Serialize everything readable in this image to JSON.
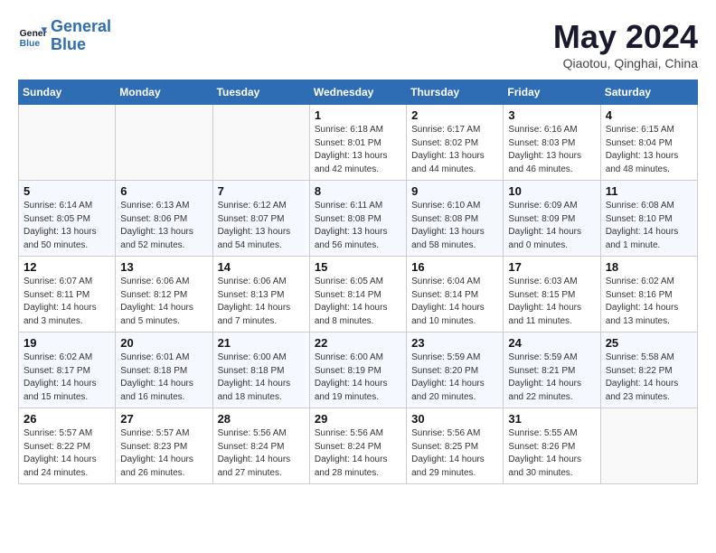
{
  "header": {
    "logo_line1": "General",
    "logo_line2": "Blue",
    "month_title": "May 2024",
    "location": "Qiaotou, Qinghai, China"
  },
  "weekdays": [
    "Sunday",
    "Monday",
    "Tuesday",
    "Wednesday",
    "Thursday",
    "Friday",
    "Saturday"
  ],
  "weeks": [
    [
      {
        "day": "",
        "info": ""
      },
      {
        "day": "",
        "info": ""
      },
      {
        "day": "",
        "info": ""
      },
      {
        "day": "1",
        "info": "Sunrise: 6:18 AM\nSunset: 8:01 PM\nDaylight: 13 hours\nand 42 minutes."
      },
      {
        "day": "2",
        "info": "Sunrise: 6:17 AM\nSunset: 8:02 PM\nDaylight: 13 hours\nand 44 minutes."
      },
      {
        "day": "3",
        "info": "Sunrise: 6:16 AM\nSunset: 8:03 PM\nDaylight: 13 hours\nand 46 minutes."
      },
      {
        "day": "4",
        "info": "Sunrise: 6:15 AM\nSunset: 8:04 PM\nDaylight: 13 hours\nand 48 minutes."
      }
    ],
    [
      {
        "day": "5",
        "info": "Sunrise: 6:14 AM\nSunset: 8:05 PM\nDaylight: 13 hours\nand 50 minutes."
      },
      {
        "day": "6",
        "info": "Sunrise: 6:13 AM\nSunset: 8:06 PM\nDaylight: 13 hours\nand 52 minutes."
      },
      {
        "day": "7",
        "info": "Sunrise: 6:12 AM\nSunset: 8:07 PM\nDaylight: 13 hours\nand 54 minutes."
      },
      {
        "day": "8",
        "info": "Sunrise: 6:11 AM\nSunset: 8:08 PM\nDaylight: 13 hours\nand 56 minutes."
      },
      {
        "day": "9",
        "info": "Sunrise: 6:10 AM\nSunset: 8:08 PM\nDaylight: 13 hours\nand 58 minutes."
      },
      {
        "day": "10",
        "info": "Sunrise: 6:09 AM\nSunset: 8:09 PM\nDaylight: 14 hours\nand 0 minutes."
      },
      {
        "day": "11",
        "info": "Sunrise: 6:08 AM\nSunset: 8:10 PM\nDaylight: 14 hours\nand 1 minute."
      }
    ],
    [
      {
        "day": "12",
        "info": "Sunrise: 6:07 AM\nSunset: 8:11 PM\nDaylight: 14 hours\nand 3 minutes."
      },
      {
        "day": "13",
        "info": "Sunrise: 6:06 AM\nSunset: 8:12 PM\nDaylight: 14 hours\nand 5 minutes."
      },
      {
        "day": "14",
        "info": "Sunrise: 6:06 AM\nSunset: 8:13 PM\nDaylight: 14 hours\nand 7 minutes."
      },
      {
        "day": "15",
        "info": "Sunrise: 6:05 AM\nSunset: 8:14 PM\nDaylight: 14 hours\nand 8 minutes."
      },
      {
        "day": "16",
        "info": "Sunrise: 6:04 AM\nSunset: 8:14 PM\nDaylight: 14 hours\nand 10 minutes."
      },
      {
        "day": "17",
        "info": "Sunrise: 6:03 AM\nSunset: 8:15 PM\nDaylight: 14 hours\nand 11 minutes."
      },
      {
        "day": "18",
        "info": "Sunrise: 6:02 AM\nSunset: 8:16 PM\nDaylight: 14 hours\nand 13 minutes."
      }
    ],
    [
      {
        "day": "19",
        "info": "Sunrise: 6:02 AM\nSunset: 8:17 PM\nDaylight: 14 hours\nand 15 minutes."
      },
      {
        "day": "20",
        "info": "Sunrise: 6:01 AM\nSunset: 8:18 PM\nDaylight: 14 hours\nand 16 minutes."
      },
      {
        "day": "21",
        "info": "Sunrise: 6:00 AM\nSunset: 8:18 PM\nDaylight: 14 hours\nand 18 minutes."
      },
      {
        "day": "22",
        "info": "Sunrise: 6:00 AM\nSunset: 8:19 PM\nDaylight: 14 hours\nand 19 minutes."
      },
      {
        "day": "23",
        "info": "Sunrise: 5:59 AM\nSunset: 8:20 PM\nDaylight: 14 hours\nand 20 minutes."
      },
      {
        "day": "24",
        "info": "Sunrise: 5:59 AM\nSunset: 8:21 PM\nDaylight: 14 hours\nand 22 minutes."
      },
      {
        "day": "25",
        "info": "Sunrise: 5:58 AM\nSunset: 8:22 PM\nDaylight: 14 hours\nand 23 minutes."
      }
    ],
    [
      {
        "day": "26",
        "info": "Sunrise: 5:57 AM\nSunset: 8:22 PM\nDaylight: 14 hours\nand 24 minutes."
      },
      {
        "day": "27",
        "info": "Sunrise: 5:57 AM\nSunset: 8:23 PM\nDaylight: 14 hours\nand 26 minutes."
      },
      {
        "day": "28",
        "info": "Sunrise: 5:56 AM\nSunset: 8:24 PM\nDaylight: 14 hours\nand 27 minutes."
      },
      {
        "day": "29",
        "info": "Sunrise: 5:56 AM\nSunset: 8:24 PM\nDaylight: 14 hours\nand 28 minutes."
      },
      {
        "day": "30",
        "info": "Sunrise: 5:56 AM\nSunset: 8:25 PM\nDaylight: 14 hours\nand 29 minutes."
      },
      {
        "day": "31",
        "info": "Sunrise: 5:55 AM\nSunset: 8:26 PM\nDaylight: 14 hours\nand 30 minutes."
      },
      {
        "day": "",
        "info": ""
      }
    ]
  ]
}
